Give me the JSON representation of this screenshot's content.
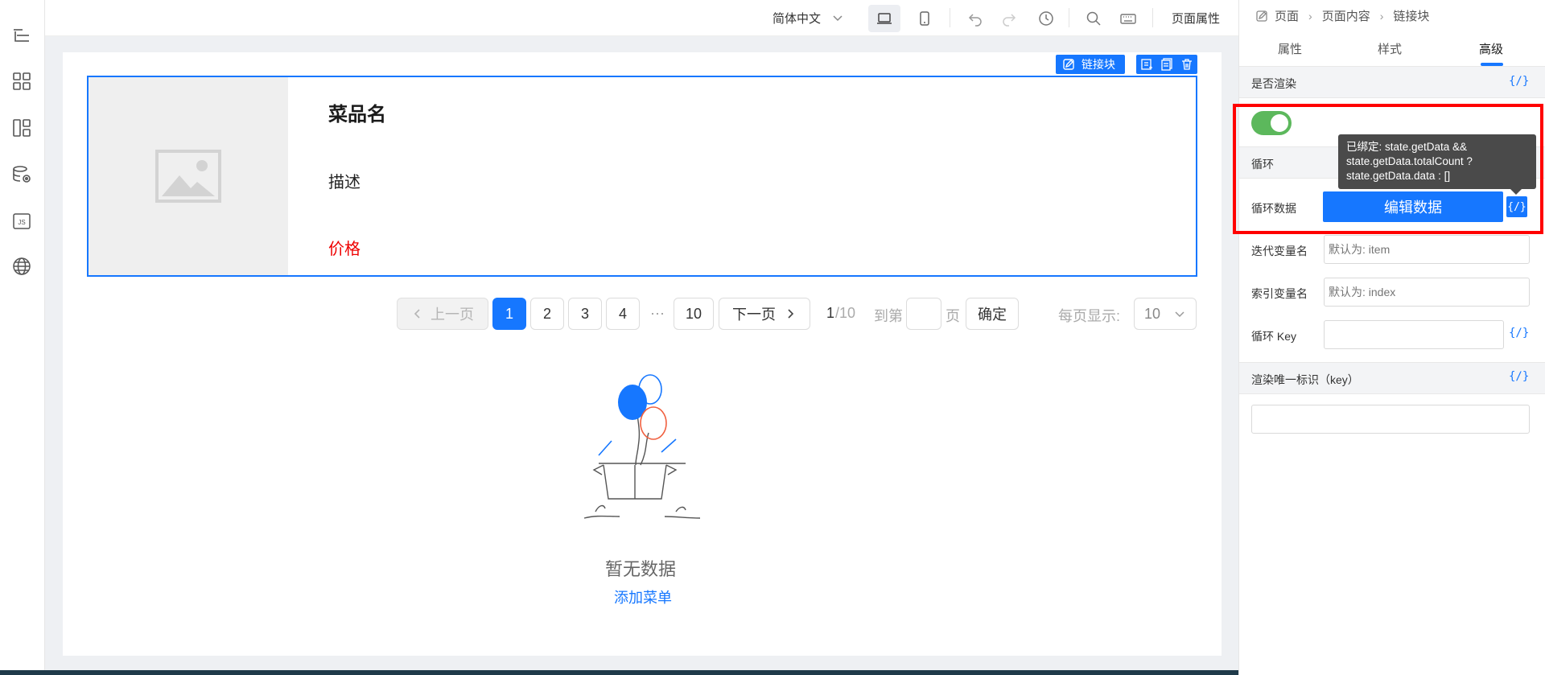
{
  "rail": {
    "icons": [
      "outline-tree-icon",
      "components-grid-icon",
      "layout-blocks-icon",
      "data-source-icon",
      "js-script-icon",
      "globe-icon"
    ],
    "js_label": "JS"
  },
  "toolbar": {
    "language": "简体中文",
    "page_properties": "页面属性"
  },
  "card": {
    "tag_label": "链接块",
    "name": "菜品名",
    "description": "描述",
    "price": "价格",
    "price_color": "#ee0000"
  },
  "pagination": {
    "prev": "上一页",
    "next": "下一页",
    "pages": [
      "1",
      "2",
      "3",
      "4"
    ],
    "ellipsis": "···",
    "last_page": "10",
    "current": "1",
    "total": "/10",
    "goto_prefix": "到第",
    "goto_suffix": "页",
    "confirm": "确定",
    "page_size_label": "每页显示:",
    "page_size": "10"
  },
  "empty": {
    "title": "暂无数据",
    "link": "添加菜单"
  },
  "panel": {
    "breadcrumb": [
      "页面",
      "页面内容",
      "链接块"
    ],
    "tabs": [
      "属性",
      "样式",
      "高级"
    ],
    "active_tab": "高级",
    "render_label": "是否渲染",
    "render_enabled": true,
    "loop_section": "循环",
    "loop_data_label": "循环数据",
    "edit_data_button": "编辑数据",
    "iter_var_label": "迭代变量名",
    "iter_var_placeholder": "默认为: item",
    "index_var_label": "索引变量名",
    "index_var_placeholder": "默认为: index",
    "loop_key_label": "循环 Key",
    "render_key_section": "渲染唯一标识（key）",
    "bind_symbol": "{/}",
    "tooltip_lines": [
      "已绑定: state.getData &&",
      "state.getData.totalCount ?",
      "state.getData.data : []"
    ]
  },
  "colors": {
    "accent": "#1677ff",
    "toggle_on": "#5cb85c",
    "highlight_box": "#ff0000"
  }
}
